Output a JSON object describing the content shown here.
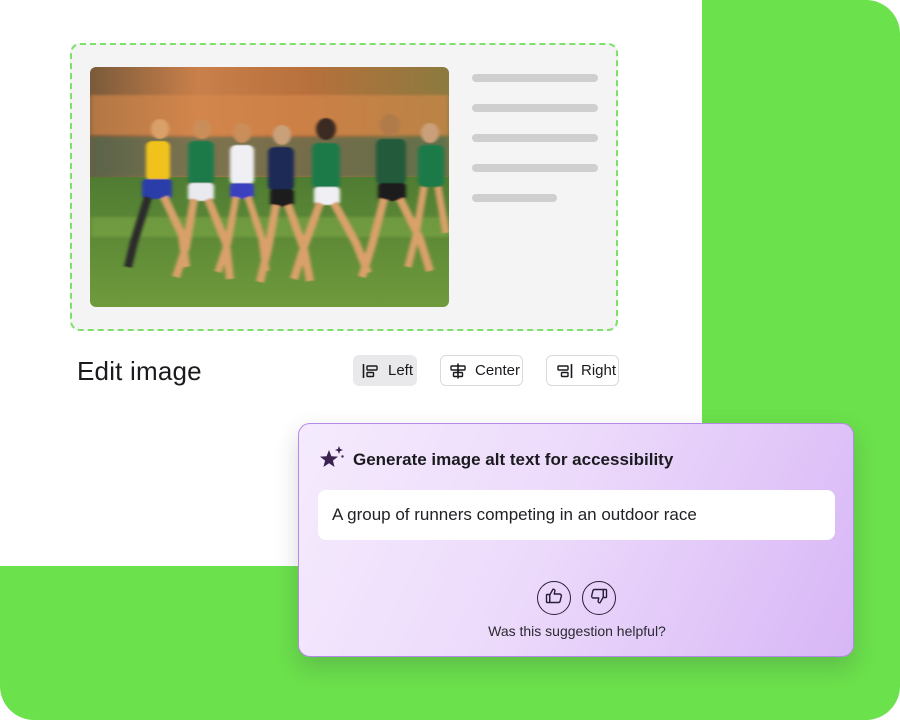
{
  "editor": {
    "title": "Edit image",
    "alignment": {
      "selected": "Left",
      "options": [
        {
          "label": "Left",
          "icon": "align-left-icon"
        },
        {
          "label": "Center",
          "icon": "align-center-icon"
        },
        {
          "label": "Right",
          "icon": "align-right-icon"
        }
      ]
    },
    "placeholder_line_count": 5
  },
  "ai_panel": {
    "icon": "sparkle-star-icon",
    "title": "Generate image alt text for accessibility",
    "suggestion": "A group of runners competing in an outdoor race",
    "feedback_prompt": "Was this suggestion helpful?",
    "feedback_icons": [
      "thumbs-up-icon",
      "thumbs-down-icon"
    ]
  },
  "colors": {
    "accent_green": "#6be14b",
    "dashed_border": "#7de068",
    "ai_border": "#b58ae6",
    "ai_gradient_end": "#d8b6f6",
    "ink": "#2a1f38"
  }
}
